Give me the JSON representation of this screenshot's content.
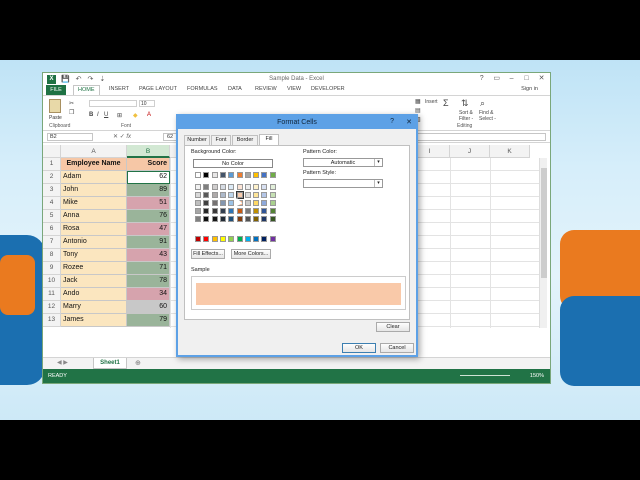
{
  "window": {
    "title": "Sample Data - Excel",
    "logo_text": "X",
    "qat": [
      "💾",
      "↶",
      "↷",
      "⇣"
    ],
    "controls": [
      "?",
      "▭",
      "–",
      "□",
      "✕"
    ]
  },
  "ribbon": {
    "tabs": [
      "FILE",
      "HOME",
      "INSERT",
      "PAGE LAYOUT",
      "FORMULAS",
      "DATA",
      "REVIEW",
      "VIEW",
      "DEVELOPER"
    ],
    "active_tab": "HOME",
    "signin": "Sign in",
    "group_labels": [
      "Clipboard",
      "Font",
      "Editing"
    ],
    "paste_label": "Paste",
    "insert_label": "Insert",
    "sort_label": "Sort &",
    "filter_label": "Filter -",
    "find_label": "Find &",
    "select_label": "Select -",
    "font_size": "10"
  },
  "formula_bar": {
    "name_box": "B2",
    "fx_label": "fx",
    "value": "62"
  },
  "sheet": {
    "columns": [
      "A",
      "B",
      "C",
      "D",
      "E",
      "F",
      "G",
      "H",
      "I",
      "J",
      "K"
    ],
    "selected_column": "B",
    "rows": [
      {
        "num": "1",
        "name": "Employee Name",
        "score": "Score",
        "color": "#f6c7a6"
      },
      {
        "num": "2",
        "name": "Adam",
        "score": "62",
        "color": "#ffffff"
      },
      {
        "num": "3",
        "name": "John",
        "score": "89",
        "color": "#9ab49a"
      },
      {
        "num": "4",
        "name": "Mike",
        "score": "51",
        "color": "#d6a3ad"
      },
      {
        "num": "5",
        "name": "Anna",
        "score": "76",
        "color": "#9ab49a"
      },
      {
        "num": "6",
        "name": "Rosa",
        "score": "47",
        "color": "#d6a3ad"
      },
      {
        "num": "7",
        "name": "Antonio",
        "score": "91",
        "color": "#9ab49a"
      },
      {
        "num": "8",
        "name": "Tony",
        "score": "43",
        "color": "#d6a3ad"
      },
      {
        "num": "9",
        "name": "Rozee",
        "score": "71",
        "color": "#9ab49a"
      },
      {
        "num": "10",
        "name": "Jack",
        "score": "78",
        "color": "#9ab49a"
      },
      {
        "num": "11",
        "name": "Ando",
        "score": "34",
        "color": "#d6a3ad"
      },
      {
        "num": "12",
        "name": "Marry",
        "score": "60",
        "color": "#c8c8c8"
      },
      {
        "num": "13",
        "name": "James",
        "score": "79",
        "color": "#9ab49a"
      }
    ],
    "sheet_tab": "Sheet1",
    "add_sheet": "⊕",
    "nav_arrows": "◀ ▶",
    "status_ready": "READY",
    "zoom": "150%"
  },
  "dialog": {
    "title": "Format Cells",
    "help": "?",
    "close": "✕",
    "tabs": [
      "Number",
      "Font",
      "Border",
      "Fill"
    ],
    "active_tab": "Fill",
    "background_color_label": "Background Color:",
    "no_color_label": "No Color",
    "pattern_color_label": "Pattern Color:",
    "pattern_color_value": "Automatic",
    "pattern_style_label": "Pattern Style:",
    "pattern_style_value": "",
    "fill_effects_label": "Fill Effects...",
    "more_colors_label": "More Colors...",
    "sample_label": "Sample",
    "sample_color": "#f9c9a9",
    "clear_label": "Clear",
    "ok_label": "OK",
    "cancel_label": "Cancel",
    "theme_colors": [
      [
        "#ffffff",
        "#000000",
        "#e7e6e6",
        "#44546a",
        "#5b9bd5",
        "#ed7d31",
        "#a5a5a5",
        "#ffc000",
        "#4472c4",
        "#70ad47"
      ],
      [
        "#f2f2f2",
        "#7f7f7f",
        "#d0cece",
        "#d6dce4",
        "#ddebf7",
        "#fce4d6",
        "#ededed",
        "#fff2cc",
        "#d9e1f2",
        "#e2efda"
      ],
      [
        "#d9d9d9",
        "#595959",
        "#aeaaaa",
        "#adb9ca",
        "#bdd7ee",
        "#f8cbad",
        "#dbdbdb",
        "#ffe699",
        "#b4c6e7",
        "#c6e0b4"
      ],
      [
        "#bfbfbf",
        "#404040",
        "#757171",
        "#8497b0",
        "#9bc2e6",
        "#f4b084",
        "#c9c9c9",
        "#ffd966",
        "#8ea9db",
        "#a9d08e"
      ],
      [
        "#a6a6a6",
        "#262626",
        "#3a3838",
        "#333f4f",
        "#2f75b5",
        "#c65911",
        "#7b7b7b",
        "#bf8f00",
        "#305496",
        "#548235"
      ],
      [
        "#808080",
        "#0d0d0d",
        "#161616",
        "#222b35",
        "#1f4e78",
        "#833c0c",
        "#525252",
        "#806000",
        "#203764",
        "#375623"
      ]
    ],
    "standard_colors": [
      "#c00000",
      "#ff0000",
      "#ffc000",
      "#ffff00",
      "#92d050",
      "#00b050",
      "#00b0f0",
      "#0070c0",
      "#002060",
      "#7030a0"
    ]
  },
  "colors": {
    "excel_green": "#217346",
    "dialog_border": "#5da1e6"
  }
}
